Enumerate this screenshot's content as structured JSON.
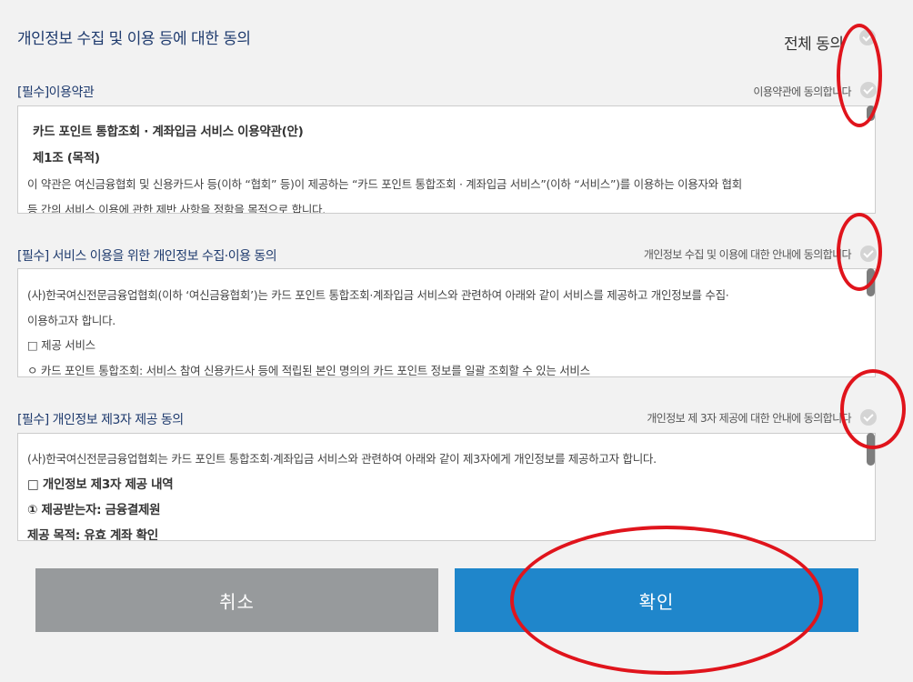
{
  "page": {
    "title": "개인정보 수집 및 이용 등에 대한 동의",
    "agree_all_label": "전체 동의"
  },
  "sections": [
    {
      "title": "[필수]이용약관",
      "agree_label": "이용약관에 동의합니다",
      "lines": [
        "카드 포인트 통합조회 · 계좌입금 서비스 이용약관(안)",
        "제1조 (목적)",
        "이 약관은 여신금융협회 및 신용카드사 등(이하 “협회” 등)이 제공하는 “카드 포인트 통합조회 · 계좌입금 서비스”(이하 “서비스”)를 이용하는 이용자와 협회",
        "등 간의 서비스 이용에 관한 제반 사항을 정함을 목적으로 합니다."
      ]
    },
    {
      "title": "[필수] 서비스 이용을 위한 개인정보 수집·이용 동의",
      "agree_label": "개인정보 수집 및 이용에 대한 안내에 동의합니다",
      "lines": [
        "(사)한국여신전문금융업협회(이하 ‘여신금융협회’)는 카드 포인트 통합조회·계좌입금 서비스와 관련하여 아래와 같이 서비스를 제공하고 개인정보를 수집·",
        "이용하고자 합니다.",
        "□ 제공 서비스",
        "ㅇ 카드 포인트 통합조회: 서비스 참여 신용카드사 등에 적립된 본인 명의의 카드 포인트 정보를 일괄 조회할 수 있는 서비스"
      ]
    },
    {
      "title": "[필수] 개인정보 제3자 제공 동의",
      "agree_label": "개인정보 제 3자 제공에 대한 안내에 동의합니다",
      "lines": [
        "(사)한국여신전문금융업협회는 카드 포인트 통합조회·계좌입금 서비스와 관련하여 아래와 같이 제3자에게 개인정보를 제공하고자 합니다.",
        "□ 개인정보 제3자 제공 내역",
        "① 제공받는자: 금융결제원",
        "제공 목적: 유효 계좌 확인"
      ]
    }
  ],
  "buttons": {
    "cancel": "취소",
    "confirm": "확인"
  },
  "colors": {
    "title": "#1f3b6e",
    "cancel_bg": "#979a9c",
    "confirm_bg": "#1f86cb",
    "annotation": "#e0141c"
  }
}
